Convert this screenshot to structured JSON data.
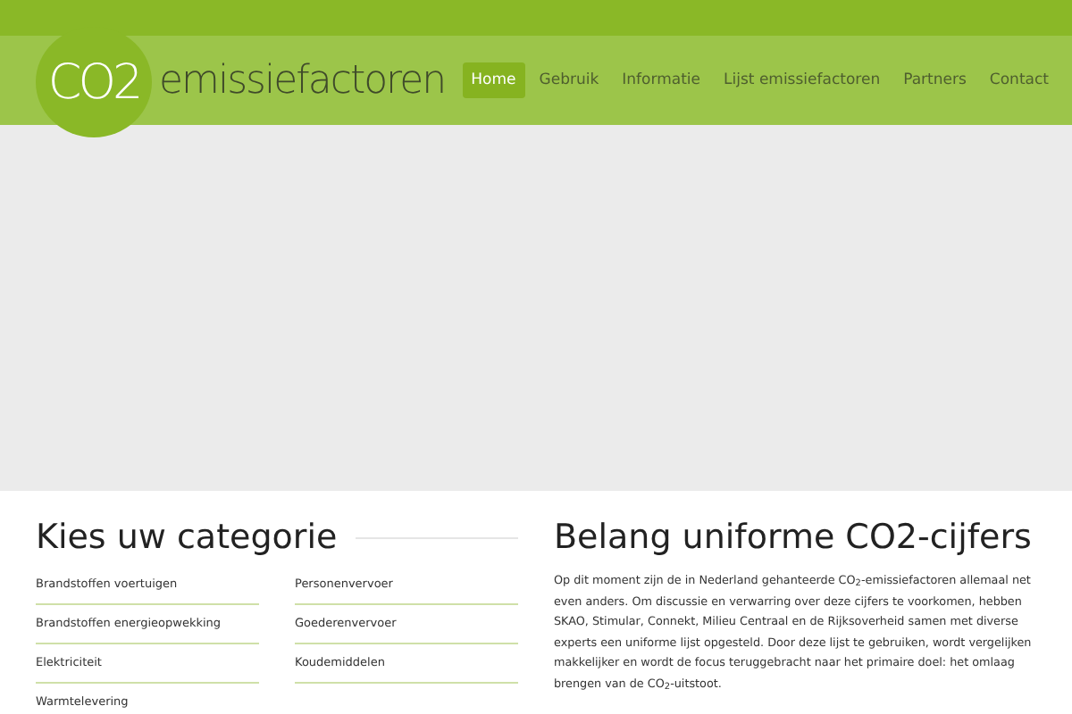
{
  "logo": {
    "mark": "CO2",
    "name": "emissiefactoren"
  },
  "nav": [
    {
      "label": "Home",
      "selected": true
    },
    {
      "label": "Gebruik",
      "selected": false
    },
    {
      "label": "Informatie",
      "selected": false
    },
    {
      "label": "Lijst emissiefactoren",
      "selected": false
    },
    {
      "label": "Partners",
      "selected": false
    },
    {
      "label": "Contact",
      "selected": false
    }
  ],
  "categories": {
    "title": "Kies uw categorie",
    "columns": [
      [
        "Brandstoffen voertuigen",
        "Brandstoffen energieopwekking",
        "Elektriciteit",
        "Warmtelevering"
      ],
      [
        "Personenvervoer",
        "Goederenvervoer",
        "Koudemiddelen"
      ]
    ]
  },
  "article": {
    "title": "Belang uniforme CO2-cijfers",
    "text": "Op dit moment zijn de in Nederland gehanteerde CO$_{2}$-emissiefactoren allemaal net even anders. Om discussie en verwarring over deze cijfers te voorkomen, hebben SKAO, Stimular, Connekt, Milieu Centraal en de Rijksoverheid samen met diverse experts een uniforme lijst opgesteld. Door deze lijst te gebruiken, wordt vergelijken makkelijker en wordt de focus teruggebracht naar het primaire doel: het omlaag brengen van de CO$_{2}$-uitstoot."
  }
}
